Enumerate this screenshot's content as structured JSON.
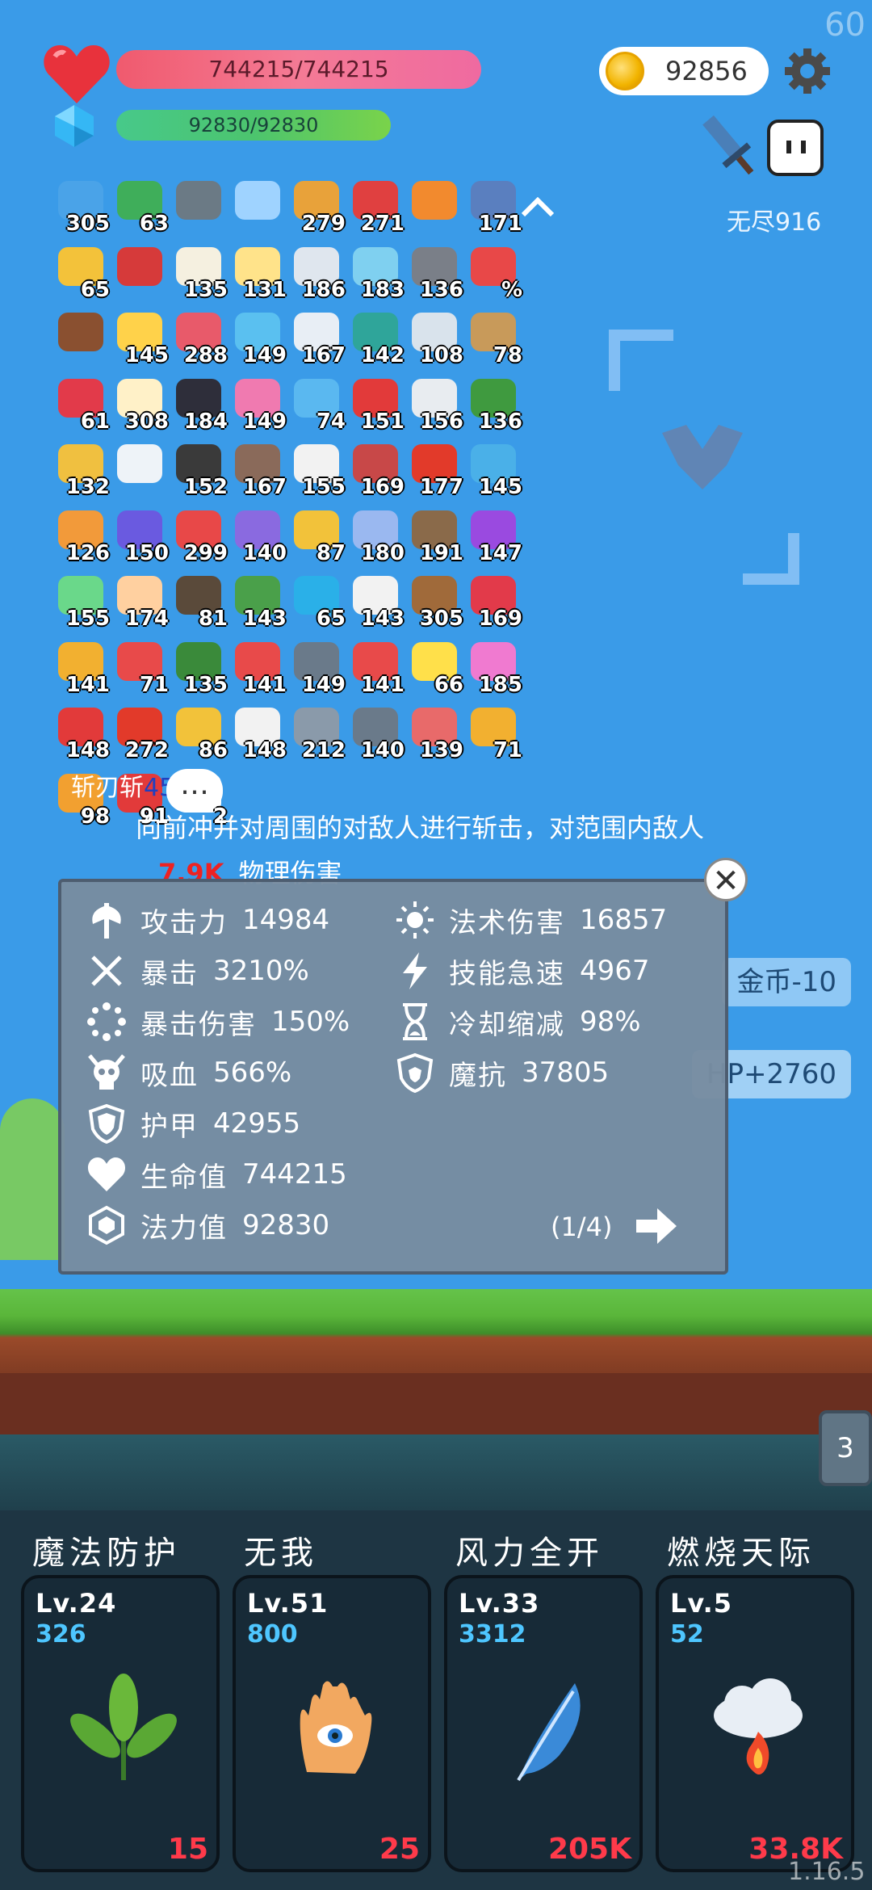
{
  "fps": "60",
  "hp": {
    "text": "744215/744215"
  },
  "mp": {
    "text": "92830/92830"
  },
  "coins": "92856",
  "mode": "无尽916",
  "items": [
    {
      "n": "305",
      "c": "#4aa3e8"
    },
    {
      "n": "63",
      "c": "#3fae5a"
    },
    {
      "n": "",
      "c": "#6b7a85"
    },
    {
      "n": "",
      "c": "#9fd3ff"
    },
    {
      "n": "279",
      "c": "#e8a23a"
    },
    {
      "n": "271",
      "c": "#e04040"
    },
    {
      "n": "",
      "c": "#f28a2e"
    },
    {
      "n": "171",
      "c": "#5a7fbf"
    },
    {
      "n": "65",
      "c": "#f3c23a"
    },
    {
      "n": "",
      "c": "#d63a3a"
    },
    {
      "n": "135",
      "c": "#f5f0e0"
    },
    {
      "n": "131",
      "c": "#ffe38a"
    },
    {
      "n": "186",
      "c": "#dfe6ee"
    },
    {
      "n": "183",
      "c": "#7fd0f0"
    },
    {
      "n": "136",
      "c": "#7a7f88"
    },
    {
      "n": "%",
      "c": "#e84848"
    },
    {
      "n": "",
      "c": "#8a5030"
    },
    {
      "n": "145",
      "c": "#ffd24a"
    },
    {
      "n": "288",
      "c": "#e85a6a"
    },
    {
      "n": "149",
      "c": "#5ac0f0"
    },
    {
      "n": "167",
      "c": "#e8eef5"
    },
    {
      "n": "142",
      "c": "#2fa59a"
    },
    {
      "n": "108",
      "c": "#d9e3ec"
    },
    {
      "n": "78",
      "c": "#c89a5a"
    },
    {
      "n": "61",
      "c": "#e23a4a"
    },
    {
      "n": "308",
      "c": "#fff1c8"
    },
    {
      "n": "184",
      "c": "#2e2e3a"
    },
    {
      "n": "149",
      "c": "#f07ab0"
    },
    {
      "n": "74",
      "c": "#5ab8f0"
    },
    {
      "n": "151",
      "c": "#e23a3a"
    },
    {
      "n": "156",
      "c": "#e8ecf0"
    },
    {
      "n": "136",
      "c": "#3f9a3f"
    },
    {
      "n": "132",
      "c": "#f0c040"
    },
    {
      "n": "",
      "c": "#eef3f8"
    },
    {
      "n": "152",
      "c": "#3a3a3a"
    },
    {
      "n": "167",
      "c": "#8a6a5a"
    },
    {
      "n": "155",
      "c": "#f2f2f2"
    },
    {
      "n": "169",
      "c": "#c84848"
    },
    {
      "n": "177",
      "c": "#e23a2a"
    },
    {
      "n": "145",
      "c": "#4ab0e8"
    },
    {
      "n": "126",
      "c": "#f29a3a"
    },
    {
      "n": "150",
      "c": "#6a5ae0"
    },
    {
      "n": "299",
      "c": "#e84848"
    },
    {
      "n": "140",
      "c": "#8a6ae0"
    },
    {
      "n": "87",
      "c": "#f2c23a"
    },
    {
      "n": "180",
      "c": "#9ab8f0"
    },
    {
      "n": "191",
      "c": "#8a6a4a"
    },
    {
      "n": "147",
      "c": "#9a4ae0"
    },
    {
      "n": "155",
      "c": "#6ad88a"
    },
    {
      "n": "174",
      "c": "#ffd0a0"
    },
    {
      "n": "81",
      "c": "#5a4a3a"
    },
    {
      "n": "143",
      "c": "#4aa04a"
    },
    {
      "n": "65",
      "c": "#2ab0e8"
    },
    {
      "n": "143",
      "c": "#f2f2f2"
    },
    {
      "n": "305",
      "c": "#a06a3a"
    },
    {
      "n": "169",
      "c": "#e23a4a"
    },
    {
      "n": "141",
      "c": "#f2b030"
    },
    {
      "n": "71",
      "c": "#e84a4a"
    },
    {
      "n": "135",
      "c": "#3a8a3a"
    },
    {
      "n": "141",
      "c": "#e84a4a"
    },
    {
      "n": "149",
      "c": "#6a7a8a"
    },
    {
      "n": "141",
      "c": "#e84a4a"
    },
    {
      "n": "66",
      "c": "#ffe04a"
    },
    {
      "n": "185",
      "c": "#f07ad0"
    },
    {
      "n": "148",
      "c": "#e23a3a"
    },
    {
      "n": "272",
      "c": "#e23a2a"
    },
    {
      "n": "86",
      "c": "#f2c23a"
    },
    {
      "n": "148",
      "c": "#f2f2f2"
    },
    {
      "n": "212",
      "c": "#8a9aaa"
    },
    {
      "n": "140",
      "c": "#6a7a8a"
    },
    {
      "n": "139",
      "c": "#e86a6a"
    },
    {
      "n": "71",
      "c": "#f2b030"
    },
    {
      "n": "98",
      "c": "#f2a030"
    },
    {
      "n": "91",
      "c": "#e23a3a"
    },
    {
      "n": "2",
      "c": "#ffffff"
    }
  ],
  "skill_preview": {
    "name": "斩刃斩",
    "level": "45]:",
    "desc": "向前冲并对周围的对敌人进行斩击，对范围内敌人",
    "damage": "7.9K",
    "damage_type": "物理伤害",
    "bubble": "…"
  },
  "side_tags": {
    "gold": "金币-10",
    "hp": "HP+2760"
  },
  "stats": {
    "left": [
      {
        "icon": "axe-icon",
        "label": "攻击力",
        "value": "14984"
      },
      {
        "icon": "crit-icon",
        "label": "暴击",
        "value": "3210%"
      },
      {
        "icon": "crit-damage-icon",
        "label": "暴击伤害",
        "value": "150%"
      },
      {
        "icon": "skull-icon",
        "label": "吸血",
        "value": "566%"
      },
      {
        "icon": "shield-icon",
        "label": "护甲",
        "value": "42955"
      },
      {
        "icon": "heart-icon",
        "label": "生命值",
        "value": "744215"
      },
      {
        "icon": "gem-icon",
        "label": "法力值",
        "value": "92830"
      }
    ],
    "right": [
      {
        "icon": "sun-icon",
        "label": "法术伤害",
        "value": "16857"
      },
      {
        "icon": "bolt-icon",
        "label": "技能急速",
        "value": "4967"
      },
      {
        "icon": "hourglass-icon",
        "label": "冷却缩减",
        "value": "98%"
      },
      {
        "icon": "magic-shield-icon",
        "label": "魔抗",
        "value": "37805"
      }
    ],
    "page": "(1/4)"
  },
  "tab_badge": "3",
  "skills": [
    {
      "title": "魔法防护",
      "lv": "Lv.24",
      "pts": "326",
      "cost": "15",
      "art": "leaf-icon"
    },
    {
      "title": "无我",
      "lv": "Lv.51",
      "pts": "800",
      "cost": "25",
      "art": "hand-eye-icon"
    },
    {
      "title": "风力全开",
      "lv": "Lv.33",
      "pts": "3312",
      "cost": "205K",
      "art": "feather-icon"
    },
    {
      "title": "燃烧天际",
      "lv": "Lv.5",
      "pts": "52",
      "cost": "33.8K",
      "art": "fire-cloud-icon"
    }
  ],
  "version": "1.16.5"
}
